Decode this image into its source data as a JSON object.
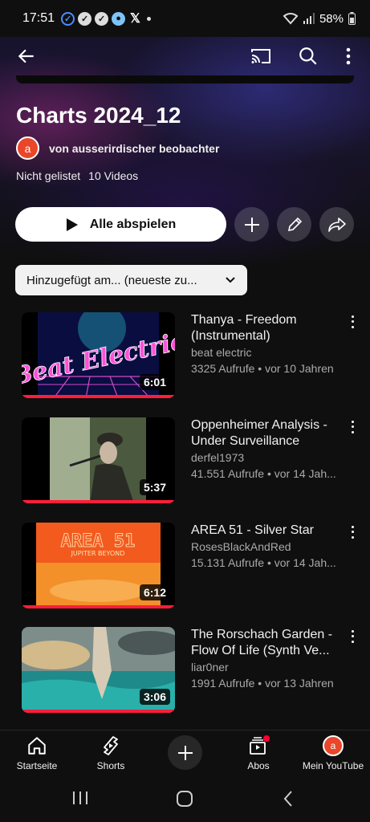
{
  "status_bar": {
    "time": "17:51",
    "battery": "58%"
  },
  "playlist": {
    "title": "Charts 2024_12",
    "owner_initial": "a",
    "owner": "von ausserirdischer beobachter",
    "visibility": "Nicht gelistet",
    "video_count": "10 Videos"
  },
  "actions": {
    "play_all": "Alle abspielen"
  },
  "sort": {
    "label": "Hinzugefügt am... (neueste zu..."
  },
  "videos": [
    {
      "title": "Thanya - Freedom (Instrumental)",
      "channel": "beat electric",
      "stats": "3325 Aufrufe • vor 10 Jahren",
      "duration": "6:01",
      "thumb_text": "Beat Electric"
    },
    {
      "title": "Oppenheimer Analysis - Under Surveillance",
      "channel": "derfel1973",
      "stats": "41.551 Aufrufe • vor 14 Jah...",
      "duration": "5:37"
    },
    {
      "title": "AREA 51 - Silver Star",
      "channel": "RosesBlackAndRed",
      "stats": "15.131 Aufrufe • vor 14 Jah...",
      "duration": "6:12",
      "thumb_text": "AREA 51",
      "thumb_subtext": "JUPITER BEYOND"
    },
    {
      "title": "The Rorschach Garden - Flow Of Life (Synth Ve...",
      "channel": "liar0ner",
      "stats": "1991 Aufrufe • vor 13 Jahren",
      "duration": "3:06"
    }
  ],
  "bottom_nav": {
    "home": "Startseite",
    "shorts": "Shorts",
    "subscriptions": "Abos",
    "profile": "Mein YouTube",
    "profile_initial": "a"
  },
  "colors": {
    "accent": "#ff0033",
    "progress": "#ff1e3a",
    "avatar": "#e9462a"
  }
}
